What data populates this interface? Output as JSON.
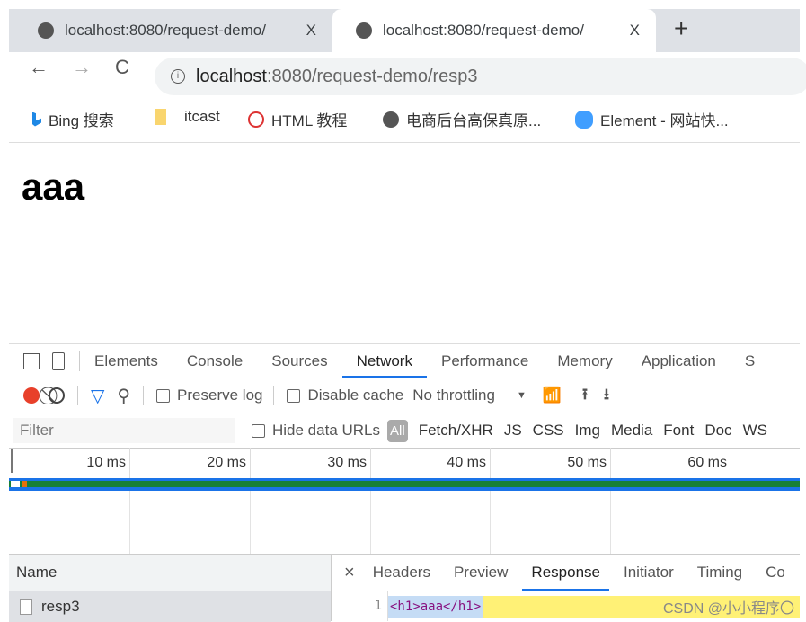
{
  "browser": {
    "tabs": [
      {
        "title": "localhost:8080/request-demo/",
        "close": "X"
      },
      {
        "title": "localhost:8080/request-demo/",
        "close": "X"
      }
    ],
    "new_tab": "+",
    "nav": {
      "back": "←",
      "forward": "→",
      "reload": "C"
    },
    "url_host": "localhost",
    "url_rest": ":8080/request-demo/resp3",
    "bookmarks": [
      {
        "label": "Bing 搜索",
        "icon": "bing-icon",
        "color": "#1e88e5"
      },
      {
        "label": "itcast",
        "icon": "folder-icon",
        "color": "#f9d56e"
      },
      {
        "label": "HTML 教程",
        "icon": "html-tutorial-icon",
        "color": "#d33"
      },
      {
        "label": "电商后台高保真原...",
        "icon": "globe-icon",
        "color": "#555"
      },
      {
        "label": "Element - 网站快...",
        "icon": "element-icon",
        "color": "#409eff"
      }
    ]
  },
  "page": {
    "heading": "aaa"
  },
  "devtools": {
    "tabs": [
      "Elements",
      "Console",
      "Sources",
      "Network",
      "Performance",
      "Memory",
      "Application",
      "S"
    ],
    "active_tab": "Network",
    "toolbar": {
      "preserve_log": "Preserve log",
      "disable_cache": "Disable cache",
      "throttling": "No throttling"
    },
    "filter": {
      "placeholder": "Filter",
      "hide_data_urls": "Hide data URLs",
      "types": [
        "All",
        "Fetch/XHR",
        "JS",
        "CSS",
        "Img",
        "Media",
        "Font",
        "Doc",
        "WS"
      ]
    },
    "timeline": {
      "ticks": [
        "10 ms",
        "20 ms",
        "30 ms",
        "40 ms",
        "50 ms",
        "60 ms"
      ]
    },
    "requests": {
      "header": "Name",
      "rows": [
        "resp3"
      ]
    },
    "detail": {
      "close": "×",
      "tabs": [
        "Headers",
        "Preview",
        "Response",
        "Initiator",
        "Timing",
        "Co"
      ],
      "active_tab": "Response",
      "line_number": "1",
      "response_code": "<h1>aaa</h1>"
    }
  },
  "watermark": "CSDN @小小程序〇"
}
